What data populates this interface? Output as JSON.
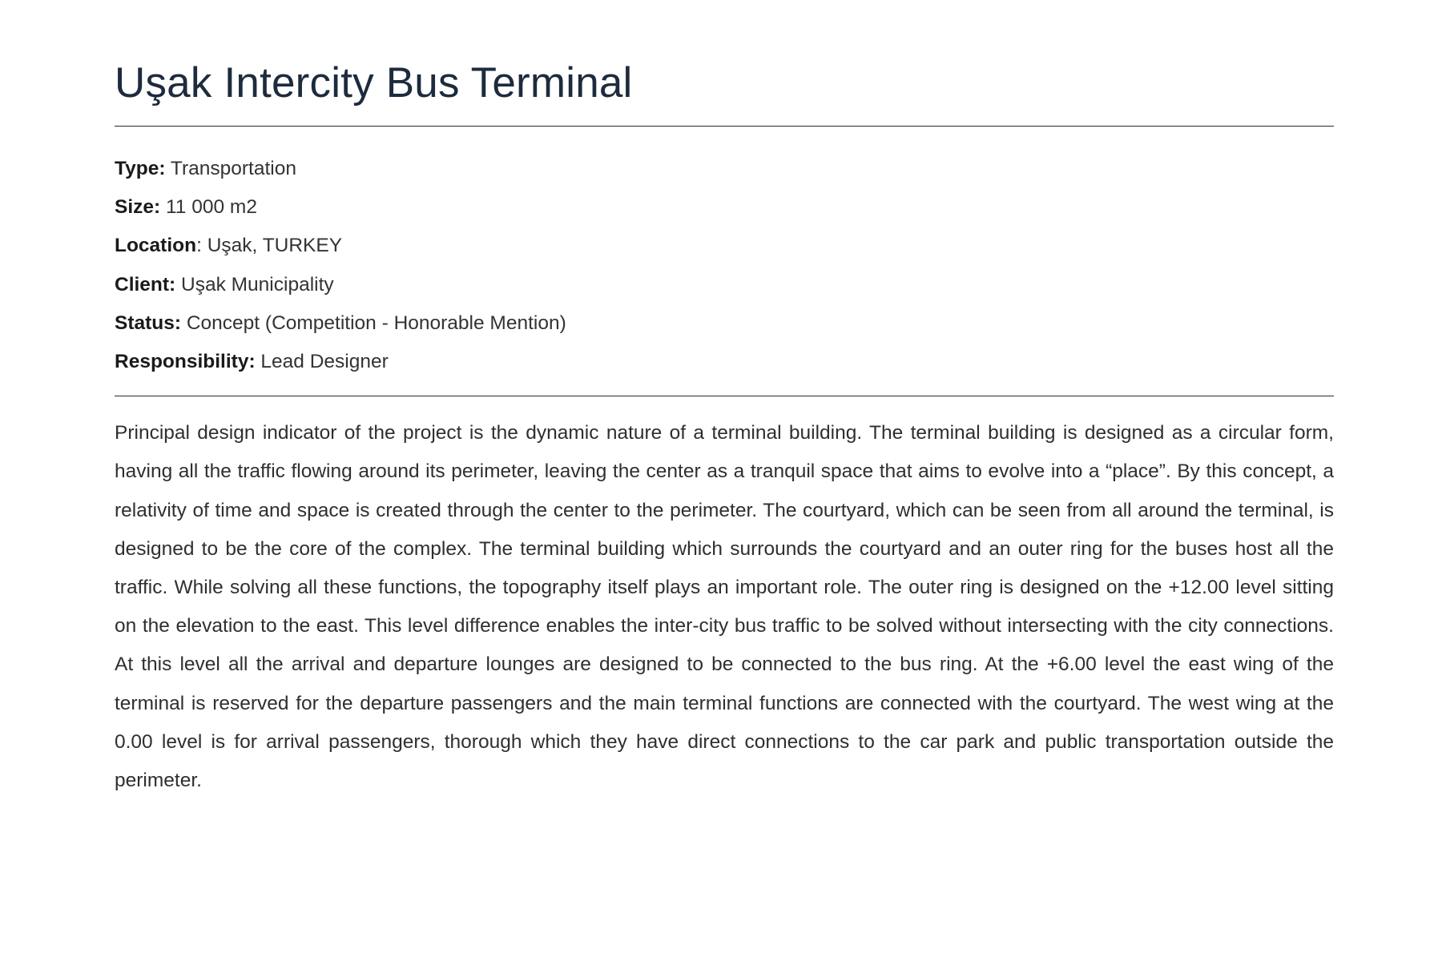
{
  "project": {
    "title": "Uşak Intercity Bus Terminal",
    "meta": [
      {
        "label": "Type:",
        "value": " Transportation"
      },
      {
        "label": "Size:",
        "value": " 11 000 m2"
      },
      {
        "label": "Location",
        "value": ": Uşak, TURKEY"
      },
      {
        "label": "Client:",
        "value": " Uşak Municipality"
      },
      {
        "label": "Status:",
        "value": " Concept (Competition - Honorable Mention)"
      },
      {
        "label": "Responsibility:",
        "value": " Lead Designer"
      }
    ],
    "description": "Principal design indicator of the project is the dynamic nature of a terminal building. The terminal building is designed as a circular form, having all the traffic flowing around its perimeter, leaving the center as a tranquil space that aims to evolve into a “place”. By this concept, a relativity of time and space is created through the center to the perimeter. The courtyard, which can be seen from all around the terminal, is designed to be the core of the complex. The terminal building which surrounds the courtyard and an outer ring for the buses host all the traffic. While solving all these functions, the topography itself plays an important role. The outer ring is designed on the +12.00 level sitting on the elevation to the east. This level difference enables the inter-city bus traffic to be solved without intersecting with the city connections.  At this level all the arrival and departure lounges are designed to be connected to the bus ring. At the +6.00 level the east wing of the terminal is reserved for the departure passengers and the main terminal functions are connected with the courtyard. The west wing at the 0.00 level is for arrival passengers, thorough which they have direct connections to the car park and public transportation outside the perimeter."
  }
}
